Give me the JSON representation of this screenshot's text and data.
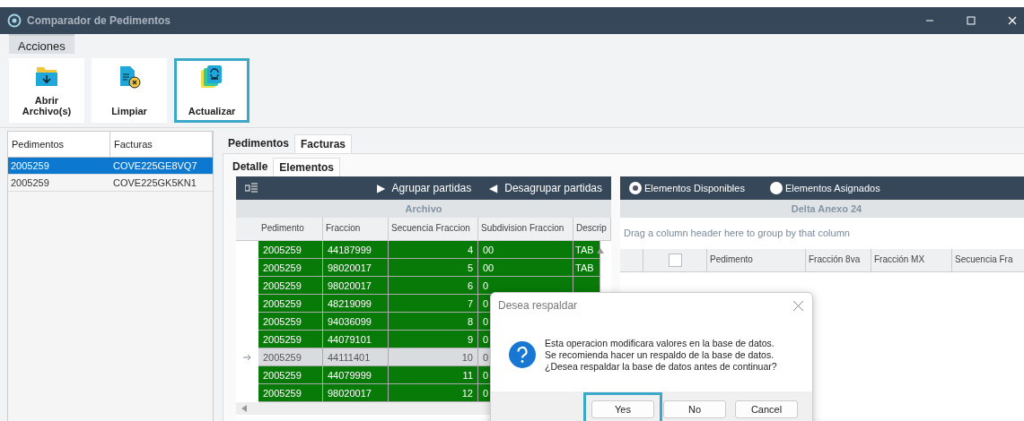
{
  "window": {
    "title": "Comparador de Pedimentos"
  },
  "ribbon": {
    "tabs": [
      {
        "label": "Acciones",
        "selected": true
      }
    ],
    "buttons": [
      {
        "label": "Abrir Archivo(s)",
        "highlighted": false
      },
      {
        "label": "Limpiar",
        "highlighted": false
      },
      {
        "label": "Actualizar",
        "highlighted": true
      }
    ]
  },
  "left_list": {
    "columns": [
      "Pedimentos",
      "Facturas"
    ],
    "rows": [
      {
        "cells": [
          "2005259",
          "COVE225GE8VQ7"
        ],
        "selected": true
      },
      {
        "cells": [
          "2005259",
          "COVE225GK5KN1"
        ],
        "selected": false
      }
    ]
  },
  "outer_tabs": [
    {
      "label": "Pedimentos",
      "selected": false
    },
    {
      "label": "Facturas",
      "selected": true
    }
  ],
  "inner_tabs": [
    {
      "label": "Detalle",
      "selected": false
    },
    {
      "label": "Elementos",
      "selected": true
    }
  ],
  "archivo_grid": {
    "toolbar": [
      {
        "glyph": "▶",
        "label": "Agrupar partidas"
      },
      {
        "glyph": "◀",
        "label": "Desagrupar partidas"
      }
    ],
    "band": "Archivo",
    "columns": [
      "Pedimento",
      "Fraccion",
      "Secuencia Fraccion",
      "Subdivision Fraccion",
      "Descrip"
    ],
    "rows": [
      {
        "cells": [
          "2005259",
          "44187999",
          "4",
          "00",
          "TAB"
        ],
        "current": false
      },
      {
        "cells": [
          "2005259",
          "98020017",
          "5",
          "00",
          "TAB"
        ],
        "current": false
      },
      {
        "cells": [
          "2005259",
          "98020017",
          "6",
          "0"
        ],
        "current": false
      },
      {
        "cells": [
          "2005259",
          "48219099",
          "7",
          "0"
        ],
        "current": false
      },
      {
        "cells": [
          "2005259",
          "94036099",
          "8",
          "0"
        ],
        "current": false
      },
      {
        "cells": [
          "2005259",
          "44079101",
          "9",
          "0"
        ],
        "current": false
      },
      {
        "cells": [
          "2005259",
          "44111401",
          "10",
          "0"
        ],
        "current": true
      },
      {
        "cells": [
          "2005259",
          "44079999",
          "11",
          "0"
        ],
        "current": false
      },
      {
        "cells": [
          "2005259",
          "98020017",
          "12",
          "0"
        ],
        "current": false
      }
    ]
  },
  "delta_grid": {
    "radios": [
      {
        "label": "Elementos Disponibles",
        "selected": true
      },
      {
        "label": "Elementos Asignados",
        "selected": false
      }
    ],
    "band": "Delta Anexo 24",
    "group_hint": "Drag a column header here to group by that column",
    "header_checkbox": {
      "checked": false
    },
    "columns": [
      "Pedimento",
      "Fracción 8va",
      "Fracción MX",
      "Secuencia Fra"
    ]
  },
  "dialog": {
    "title": "Desea respaldar",
    "lines": [
      "Esta operacion modificara valores en la base de datos.",
      "Se recomienda hacer un respaldo de la base de datos.",
      "¿Desea respaldar la base de datos antes de continuar?"
    ],
    "buttons": [
      {
        "label": "Yes",
        "highlighted": true
      },
      {
        "label": "No",
        "highlighted": false
      },
      {
        "label": "Cancel",
        "highlighted": false
      }
    ]
  }
}
